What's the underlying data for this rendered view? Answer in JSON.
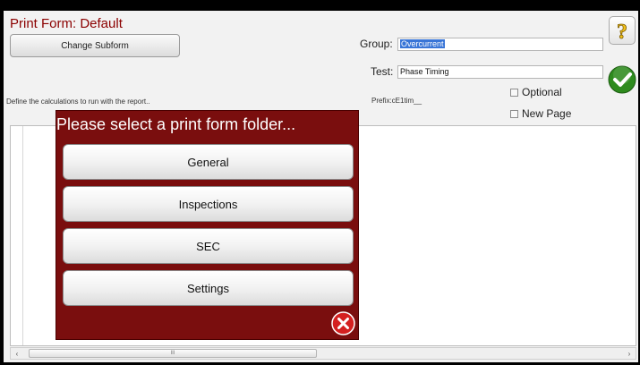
{
  "header": {
    "title": "Print Form: Default",
    "change_subform_label": "Change Subform",
    "help_glyph": "?"
  },
  "form": {
    "group_label": "Group:",
    "group_value": "Overcurrent",
    "test_label": "Test:",
    "test_value": "Phase Timing",
    "prefix_text": "Prefix:cE1tim__",
    "instructions": "Define the calculations to run with the report..",
    "optional_label": "Optional",
    "new_page_label": "New Page"
  },
  "dialog": {
    "title": "Please select a print form folder...",
    "options": [
      "General",
      "Inspections",
      "SEC",
      "Settings"
    ]
  },
  "scrollbar": {
    "left_arrow": "‹",
    "right_arrow": "›",
    "grip": "III"
  },
  "icons": {
    "help": "question-mark-icon",
    "confirm": "green-check-icon",
    "close": "red-close-icon"
  },
  "colors": {
    "title_red": "#8b0000",
    "dialog_bg": "#7a0e0e",
    "selection_blue": "#3875d7",
    "check_green": "#2e8b1e",
    "close_red": "#d42020"
  }
}
